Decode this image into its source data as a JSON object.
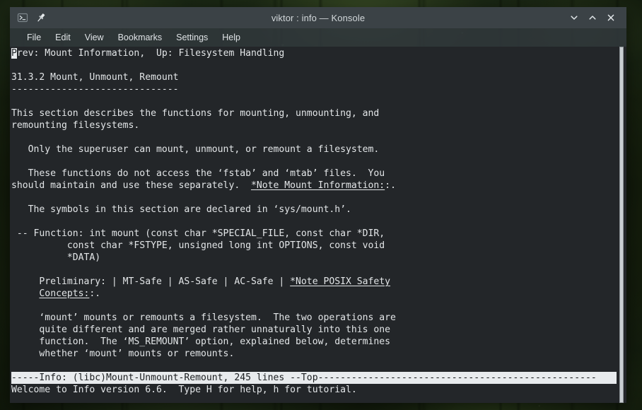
{
  "window": {
    "title": "viktor : info — Konsole",
    "app_icon": "konsole-terminal-icon",
    "pin_icon": "pin-icon",
    "controls": {
      "minimize": "˅",
      "maximize": "˄",
      "close": "✕"
    }
  },
  "menubar": {
    "items": [
      {
        "label": "File"
      },
      {
        "label": "Edit"
      },
      {
        "label": "View"
      },
      {
        "label": "Bookmarks"
      },
      {
        "label": "Settings"
      },
      {
        "label": "Help"
      }
    ]
  },
  "terminal": {
    "program": "info",
    "node": "(libc)Mount-Unmount-Remount",
    "cursor_char": "P",
    "lines": [
      {
        "type": "header",
        "pre": "",
        "cursor": "P",
        "text": "rev: Mount Information,  Up: Filesystem Handling"
      },
      {
        "type": "blank",
        "text": ""
      },
      {
        "type": "text",
        "text": "31.3.2 Mount, Unmount, Remount"
      },
      {
        "type": "text",
        "text": "------------------------------"
      },
      {
        "type": "blank",
        "text": ""
      },
      {
        "type": "text",
        "text": "This section describes the functions for mounting, unmounting, and"
      },
      {
        "type": "text",
        "text": "remounting filesystems."
      },
      {
        "type": "blank",
        "text": ""
      },
      {
        "type": "text",
        "text": "   Only the superuser can mount, unmount, or remount a filesystem."
      },
      {
        "type": "blank",
        "text": ""
      },
      {
        "type": "text",
        "text": "   These functions do not access the ‘fstab’ and ‘mtab’ files.  You"
      },
      {
        "type": "xref",
        "before": "should maintain and use these separately.  ",
        "link": "*Note Mount Information:",
        "after": ":."
      },
      {
        "type": "blank",
        "text": ""
      },
      {
        "type": "text",
        "text": "   The symbols in this section are declared in ‘sys/mount.h’."
      },
      {
        "type": "blank",
        "text": ""
      },
      {
        "type": "text",
        "text": " -- Function: int mount (const char *SPECIAL_FILE, const char *DIR,"
      },
      {
        "type": "text",
        "text": "          const char *FSTYPE, unsigned long int OPTIONS, const void"
      },
      {
        "type": "text",
        "text": "          *DATA)"
      },
      {
        "type": "blank",
        "text": ""
      },
      {
        "type": "xref",
        "before": "     Preliminary: | MT-Safe | AS-Safe | AC-Safe | ",
        "link": "*Note POSIX Safety",
        "after": ""
      },
      {
        "type": "xref",
        "before": "     ",
        "link": "Concepts:",
        "after": ":."
      },
      {
        "type": "blank",
        "text": ""
      },
      {
        "type": "text",
        "text": "     ‘mount’ mounts or remounts a filesystem.  The two operations are"
      },
      {
        "type": "text",
        "text": "     quite different and are merged rather unnaturally into this one"
      },
      {
        "type": "text",
        "text": "     function.  The ‘MS_REMOUNT’ option, explained below, determines"
      },
      {
        "type": "text",
        "text": "     whether ‘mount’ mounts or remounts."
      },
      {
        "type": "blank",
        "text": ""
      },
      {
        "type": "status",
        "text": "-----Info: (libc)Mount-Unmount-Remount, 245 lines --Top--------------------------------------------------"
      },
      {
        "type": "text",
        "text": "Welcome to Info version 6.6.  Type H for help, h for tutorial."
      }
    ],
    "status_line": "-----Info: (libc)Mount-Unmount-Remount, 245 lines --Top--------------------------------------------------",
    "welcome_line": "Welcome to Info version 6.6.  Type H for help, h for tutorial.",
    "total_lines": "245 lines",
    "position": "--Top",
    "info_version": "6.6"
  },
  "scrollbar": {
    "name": "terminal-scrollbar",
    "thumb_position": "full"
  },
  "colors": {
    "titlebar_bg": "#3b4246",
    "menubar_bg": "#30373b",
    "terminal_bg": "#232629",
    "terminal_fg": "#e3e6e8",
    "status_bg": "#e8ebed",
    "status_fg": "#1b1e20",
    "scrollbar_thumb": "#c9ced2"
  }
}
